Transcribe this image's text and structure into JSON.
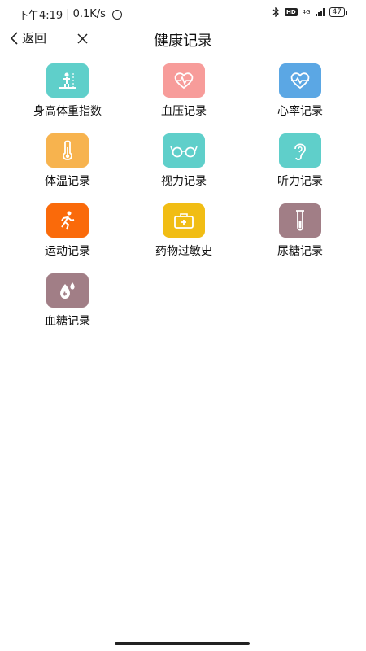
{
  "status_bar": {
    "time": "下午4:19",
    "network_speed": "0.1K/s",
    "network_type": "4G",
    "battery": "47",
    "hd_badge": "HD"
  },
  "nav": {
    "back_label": "返回",
    "title": "健康记录"
  },
  "records": [
    {
      "label": "身高体重指数",
      "color": "#5fcfca",
      "icon": "body-scale-icon"
    },
    {
      "label": "血压记录",
      "color": "#f79c9a",
      "icon": "heart-pulse-icon"
    },
    {
      "label": "心率记录",
      "color": "#5ba7e4",
      "icon": "heart-rate-icon"
    },
    {
      "label": "体温记录",
      "color": "#f7b34e",
      "icon": "thermometer-icon"
    },
    {
      "label": "视力记录",
      "color": "#5fcfca",
      "icon": "glasses-icon"
    },
    {
      "label": "听力记录",
      "color": "#5fcfca",
      "icon": "ear-icon"
    },
    {
      "label": "运动记录",
      "color": "#fa6a0a",
      "icon": "running-icon"
    },
    {
      "label": "药物过敏史",
      "color": "#f1bd14",
      "icon": "medicine-box-icon"
    },
    {
      "label": "尿糖记录",
      "color": "#a17e86",
      "icon": "test-tube-icon"
    },
    {
      "label": "血糖记录",
      "color": "#a17e86",
      "icon": "blood-drop-icon"
    }
  ]
}
